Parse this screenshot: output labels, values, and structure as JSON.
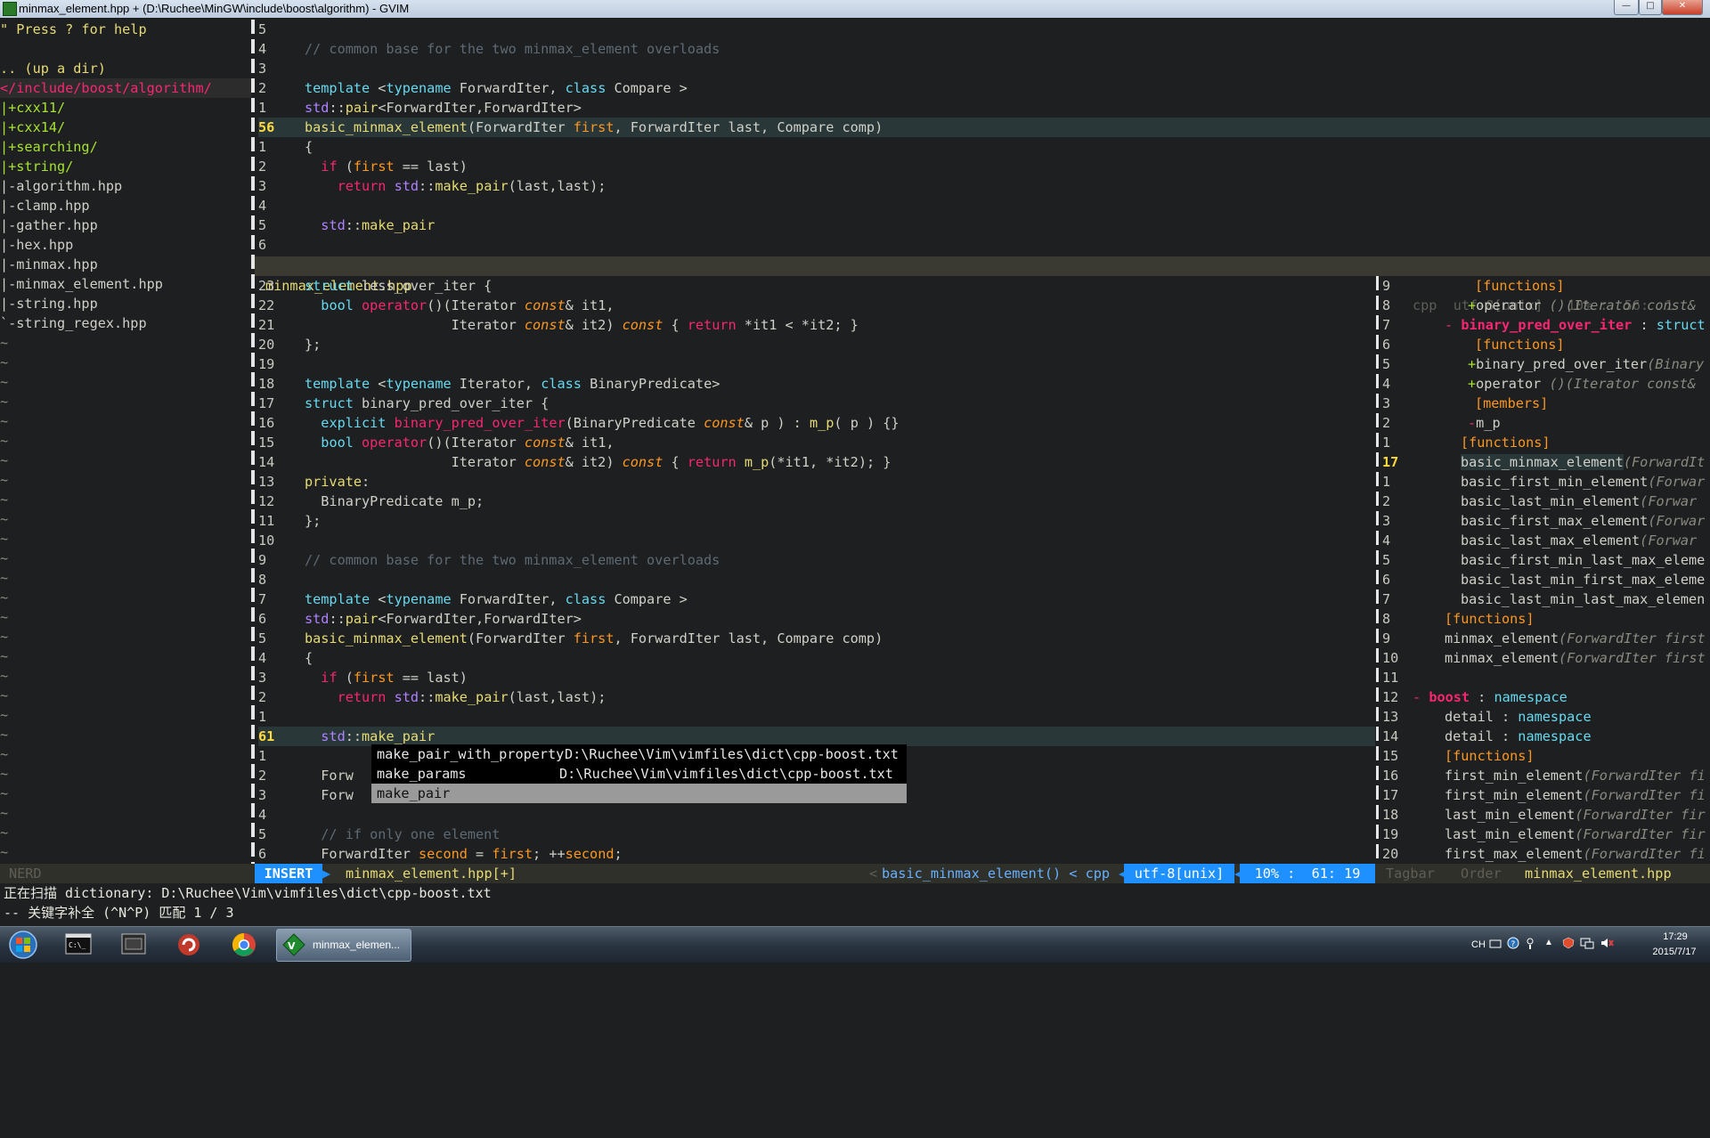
{
  "window": {
    "title": "minmax_element.hpp + (D:\\Ruchee\\MinGW\\include\\boost\\algorithm) - GVIM"
  },
  "nerdtree": {
    "help": "\" Press ? for help",
    "updir": ".. (up a dir)",
    "root": "</include/boost/algorithm/",
    "dirs": [
      "|+cxx11/",
      "|+cxx14/",
      "|+searching/",
      "|+string/"
    ],
    "files": [
      "|-algorithm.hpp",
      "|-clamp.hpp",
      "|-gather.hpp",
      "|-hex.hpp",
      "|-minmax.hpp",
      "|-minmax_element.hpp",
      "|-string.hpp",
      "`-string_regex.hpp"
    ],
    "tilde": "~"
  },
  "top_split": {
    "nums": [
      "5",
      "4",
      "3",
      "2",
      "1",
      "56",
      "1",
      "2",
      "3",
      "4",
      "5",
      "6"
    ],
    "current_line": "56"
  },
  "mid_statusline": {
    "filename": "minmax_element.hpp",
    "right": "cpp  utf-8[unix]   10% :  56:  1"
  },
  "bottom_split": {
    "nums": [
      "23",
      "22",
      "21",
      "20",
      "19",
      "18",
      "17",
      "16",
      "15",
      "14",
      "13",
      "12",
      "11",
      "10",
      "9",
      "8",
      "7",
      "6",
      "5",
      "4",
      "3",
      "2",
      "1",
      "61",
      "1",
      "2",
      "3",
      "4",
      "5",
      "6"
    ],
    "current_line": "61"
  },
  "completion": {
    "items": [
      {
        "word": "make_pair_with_property",
        "menu": "D:\\Ruchee\\Vim\\vimfiles\\dict\\cpp-boost.txt"
      },
      {
        "word": "make_params",
        "menu": "D:\\Ruchee\\Vim\\vimfiles\\dict\\cpp-boost.txt"
      },
      {
        "word": "make_pair",
        "menu": ""
      }
    ],
    "selected_index": 2
  },
  "tagbar": {
    "nums": [
      "9",
      "8",
      "7",
      "6",
      "5",
      "4",
      "3",
      "2",
      "1",
      "17",
      "1",
      "2",
      "3",
      "4",
      "5",
      "6",
      "7",
      "8",
      "9",
      "10",
      "11",
      "12",
      "13",
      "14",
      "15",
      "16",
      "17",
      "18",
      "19",
      "20"
    ],
    "current_line": "17"
  },
  "statusline": {
    "nerd": "NERD",
    "mode": "INSERT",
    "file": "minmax_element.hpp[+]",
    "func": "basic_minmax_element() < cpp",
    "enc": "utf-8[unix]",
    "pos": "10% :  61: 19",
    "tagbar": "Tagbar",
    "order": "Order",
    "tagfile": "minmax_element.hpp"
  },
  "cmdline": {
    "line1": "正在扫描 dictionary: D:\\Ruchee\\Vim\\vimfiles\\dict\\cpp-boost.txt",
    "line2": "-- 关键字补全 (^N^P) 匹配 1 / 3"
  },
  "taskbar": {
    "active_task": "minmax_elemen...",
    "lang": "CH",
    "time": "17:29",
    "date": "2015/7/17"
  },
  "colors": {
    "background": "#1d1f21",
    "keyword": "#f92672",
    "type": "#66d9ef",
    "function": "#a6e22e",
    "insert_mode": "#1e90ff"
  }
}
